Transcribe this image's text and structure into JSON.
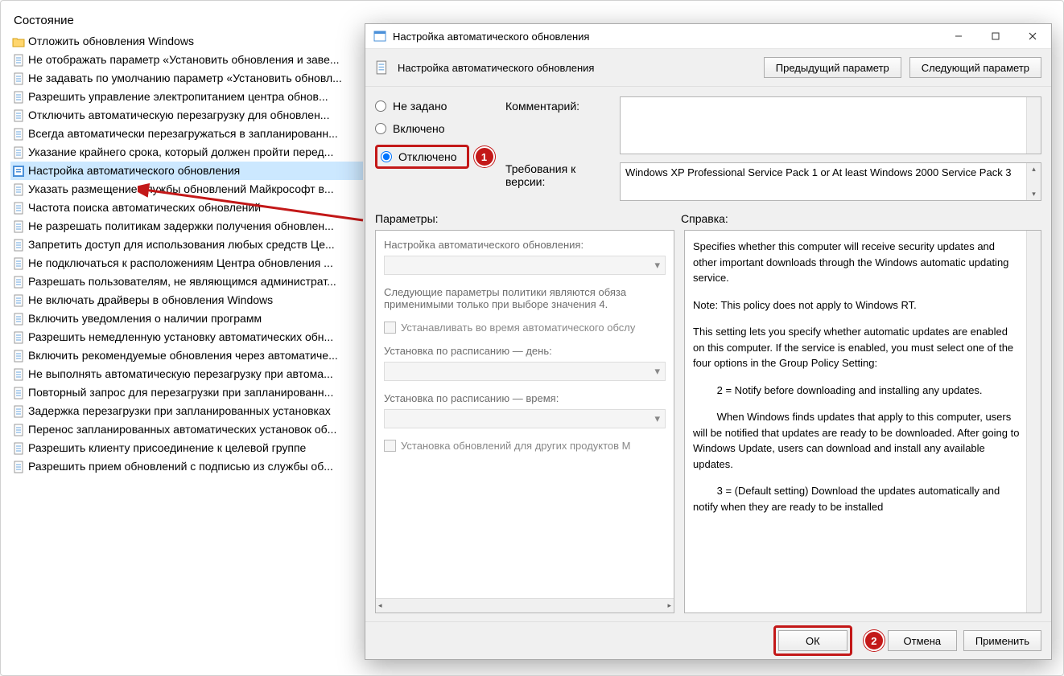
{
  "left": {
    "header": "Состояние",
    "folder": "Отложить обновления Windows",
    "items": [
      "Не отображать параметр «Установить обновления и заве...",
      "Не задавать по умолчанию параметр «Установить обновл...",
      "Разрешить управление электропитанием центра обнов...",
      "Отключить автоматическую перезагрузку для обновлен...",
      "Всегда автоматически перезагружаться в запланированн...",
      "Указание крайнего срока, который должен пройти перед...",
      "Настройка автоматического обновления",
      "Указать размещение службы обновлений Майкрософт в...",
      "Частота поиска автоматических обновлений",
      "Не разрешать политикам задержки получения обновлен...",
      "Запретить доступ для использования любых средств Це...",
      "Не подключаться к расположениям Центра обновления ...",
      "Разрешать пользователям, не являющимся администрат...",
      "Не включать драйверы в обновления Windows",
      "Включить уведомления о наличии программ",
      "Разрешить немедленную установку автоматических обн...",
      "Включить рекомендуемые обновления через автоматиче...",
      "Не выполнять автоматическую перезагрузку при автома...",
      "Повторный запрос для перезагрузки при запланированн...",
      "Задержка перезагрузки при запланированных установках",
      "Перенос запланированных автоматических установок об...",
      "Разрешить клиенту присоединение к целевой группе",
      "Разрешить прием обновлений с подписью из службы об..."
    ],
    "selected_index": 6
  },
  "dialog": {
    "title": "Настройка автоматического обновления",
    "heading": "Настройка автоматического обновления",
    "prev_btn": "Предыдущий параметр",
    "next_btn": "Следующий параметр",
    "radio_not_set": "Не задано",
    "radio_enabled": "Включено",
    "radio_disabled": "Отключено",
    "comment_label": "Комментарий:",
    "req_label": "Требования к версии:",
    "req_text": "Windows XP Professional Service Pack 1 or At least Windows 2000 Service Pack 3",
    "params_label": "Параметры:",
    "help_label": "Справка:",
    "params": {
      "p1": "Настройка автоматического обновления:",
      "p2a": "Следующие параметры политики являются обяза",
      "p2b": "применимыми только при выборе значения 4.",
      "chk1": "Устанавливать во время автоматического обслу",
      "p3": "Установка по расписанию — день:",
      "p4": "Установка по расписанию — время:",
      "chk2": "Установка обновлений для других продуктов М"
    },
    "help": {
      "p1": "Specifies whether this computer will receive security updates and other important downloads through the Windows automatic updating service.",
      "p2": "Note: This policy does not apply to Windows RT.",
      "p3": "This setting lets you specify whether automatic updates are enabled on this computer. If the service is enabled, you must select one of the four options in the Group Policy Setting:",
      "p4": "   2 = Notify before downloading and installing any updates.",
      "p5": "   When Windows finds updates that apply to this computer, users will be notified that updates are ready to be downloaded. After going to Windows Update, users can download and install any available updates.",
      "p6": "   3 = (Default setting) Download the updates automatically and notify when they are ready to be installed"
    },
    "ok": "ОК",
    "cancel": "Отмена",
    "apply": "Применить"
  },
  "steps": {
    "s1": "1",
    "s2": "2"
  }
}
